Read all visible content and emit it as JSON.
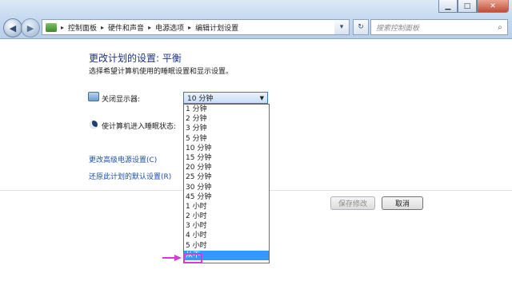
{
  "window": {
    "minimize_glyph": "▁",
    "maximize_glyph": "□",
    "close_glyph": "✕"
  },
  "address_bar": {
    "breadcrumbs": [
      "控制面板",
      "硬件和声音",
      "电源选项",
      "编辑计划设置"
    ],
    "separator": "▸",
    "back_glyph": "◀",
    "forward_glyph": "▶",
    "dropdown_glyph": "▾",
    "refresh_glyph": "↻",
    "folder_icon": "control-panel-icon"
  },
  "search": {
    "placeholder": "搜索控制面板",
    "icon": "search-icon",
    "icon_glyph": "⌕"
  },
  "page": {
    "title": "更改计划的设置: 平衡",
    "description": "选择希望计算机使用的睡眠设置和显示设置。"
  },
  "settings": {
    "display_off_label": "关闭显示器:",
    "display_off_value": "10 分钟",
    "sleep_label": "使计算机进入睡眠状态:",
    "select_arrow": "▼"
  },
  "links": {
    "advanced": "更改高级电源设置(C)",
    "restore": "还原此计划的默认设置(R)"
  },
  "buttons": {
    "save": "保存修改",
    "cancel": "取消"
  },
  "dropdown": {
    "options": [
      "1 分钟",
      "2 分钟",
      "3 分钟",
      "5 分钟",
      "10 分钟",
      "15 分钟",
      "20 分钟",
      "25 分钟",
      "30 分钟",
      "45 分钟",
      "1 小时",
      "2 小时",
      "3 小时",
      "4 小时",
      "5 小时",
      "从不"
    ],
    "selected": "从不"
  },
  "colors": {
    "selection": "#3399ff",
    "annotation": "#d63bd6",
    "title_text": "#1e3287",
    "link_text": "#1f4fa8"
  }
}
